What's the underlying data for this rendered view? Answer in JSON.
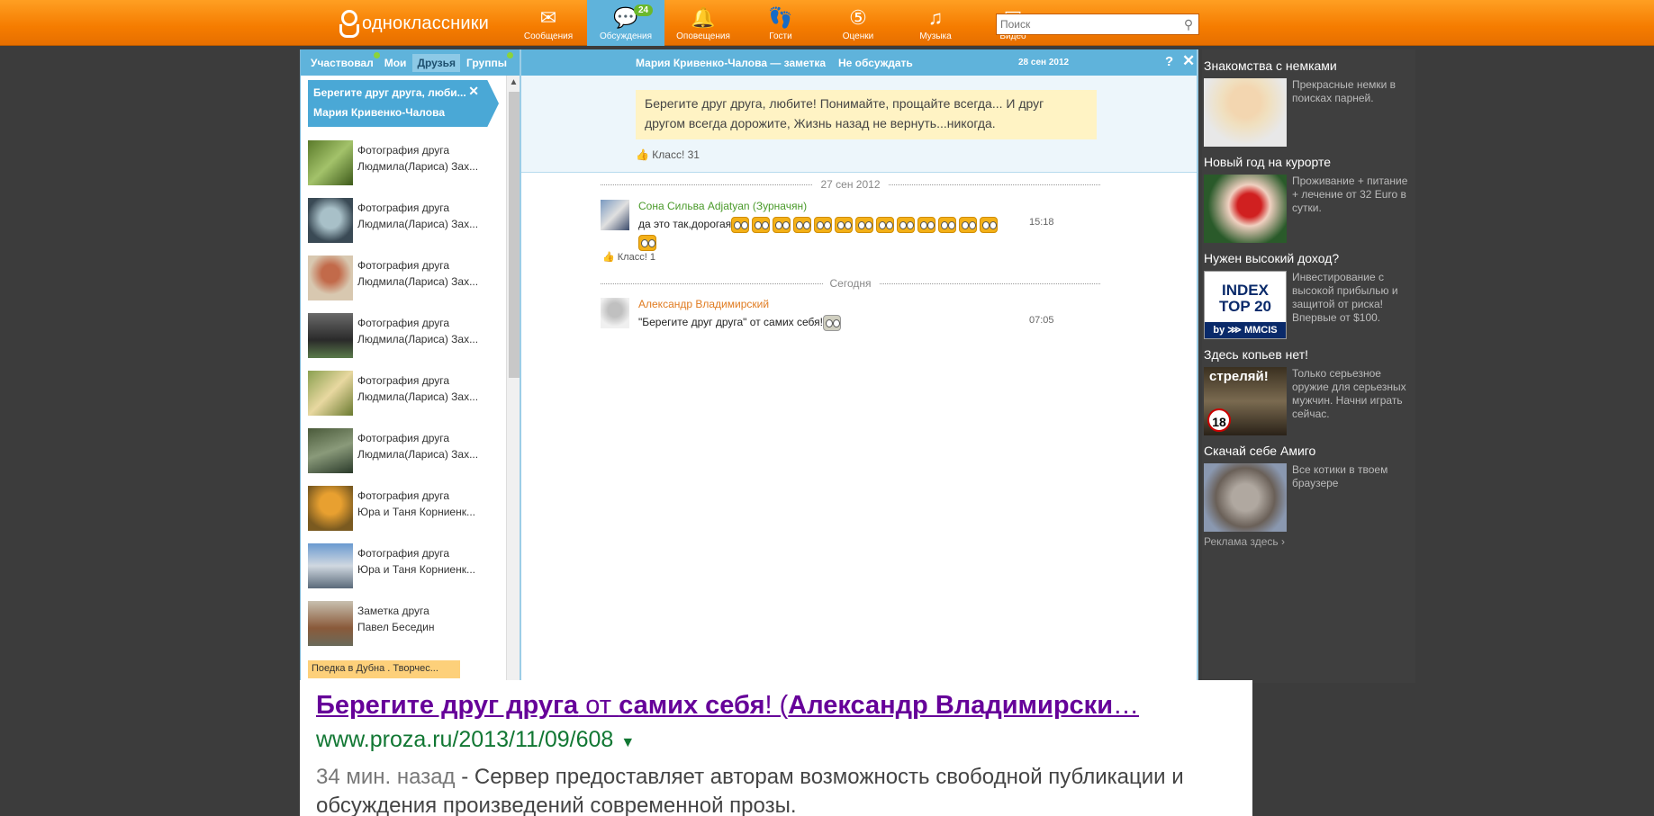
{
  "topbar": {
    "logo_text": "одноклассники",
    "nav": [
      {
        "label": "Сообщения",
        "icon": "envelope-icon",
        "glyph": "✉"
      },
      {
        "label": "Обсуждения",
        "icon": "discussions-icon",
        "glyph": "💬",
        "badge": "24",
        "active": true
      },
      {
        "label": "Оповещения",
        "icon": "bell-icon",
        "glyph": "🔔"
      },
      {
        "label": "Гости",
        "icon": "footprints-icon",
        "glyph": "👣"
      },
      {
        "label": "Оценки",
        "icon": "ratings-icon",
        "glyph": "⑤"
      },
      {
        "label": "Музыка",
        "icon": "music-icon",
        "glyph": "♫"
      },
      {
        "label": "Видео",
        "icon": "video-icon",
        "glyph": "▣"
      }
    ],
    "search_placeholder": "Поиск"
  },
  "left": {
    "tabs": [
      "Участвовал",
      "Мои",
      "Друзья",
      "Группы"
    ],
    "current": {
      "title": "Берегите друг друга, люби...",
      "author": "Мария Кривенко-Чалова"
    },
    "items": [
      {
        "type": "Фотография друга",
        "author": "Людмила(Лариса) Зах..."
      },
      {
        "type": "Фотография друга",
        "author": "Людмила(Лариса) Зах..."
      },
      {
        "type": "Фотография друга",
        "author": "Людмила(Лариса) Зах..."
      },
      {
        "type": "Фотография друга",
        "author": "Людмила(Лариса) Зах..."
      },
      {
        "type": "Фотография друга",
        "author": "Людмила(Лариса) Зах..."
      },
      {
        "type": "Фотография друга",
        "author": "Людмила(Лариса) Зах..."
      },
      {
        "type": "Фотография друга",
        "author": "Юра и Таня Корниенк..."
      },
      {
        "type": "Фотография друга",
        "author": "Юра и Таня Корниенк..."
      },
      {
        "type": "Заметка друга",
        "author": "Павел Беседин"
      }
    ],
    "tag": "Поедка в Дубна . Творчес..."
  },
  "main": {
    "header_title": "Мария Кривенко-Чалова — заметка",
    "no_discuss": "Не обсуждать",
    "date": "28 сен 2012",
    "help": "?",
    "close": "✕",
    "note": "Берегите друг друга, любите! Понимайте, прощайте всегда... И друг другом всегда дорожите, Жизнь назад не вернуть...никогда.",
    "note_class": "Класс! 31",
    "sep1": "27 сен 2012",
    "msg1": {
      "author": "Сона Сильва Adjatyan (Зурначян)",
      "text": "да это так,дорогая",
      "time": "15:18",
      "klass": "Класс! 1"
    },
    "sep2": "Сегодня",
    "msg2": {
      "author": "Александр Владимирский",
      "text": "\"Берегите друг друга\" от самих себя!",
      "time": "07:05"
    }
  },
  "ads": [
    {
      "title": "Знакомства с немками",
      "desc": "Прекрасные немки в поисках парней."
    },
    {
      "title": "Новый год на курорте",
      "desc": "Проживание + питание + лечение от 32 Euro в сутки."
    },
    {
      "title": "Нужен высокий доход?",
      "desc": "Инвестирование с высокой прибылью и защитой от риска! Впервые от $100.",
      "logo_line1": "INDEX",
      "logo_line2": "TOP 20",
      "logo_line3": "by ⋙ MMCIS"
    },
    {
      "title": "Здесь копьев нет!",
      "desc": "Только серьезное оружие для серьезных мужчин. Начни играть сейчас.",
      "banner": "стреляй!",
      "age": "18"
    },
    {
      "title": "Скачай себе Амиго",
      "desc": "Все котики в твоем браузере"
    }
  ],
  "ads_more": "Реклама здесь ›",
  "result": {
    "title_parts": [
      "Берегите друг друга",
      " от ",
      "самих себя",
      "! (",
      "Александр Владимирски",
      "…"
    ],
    "url": "www.proza.ru/2013/11/09/608",
    "ago": "34 мин. назад",
    "snippet": " - Сервер предоставляет авторам возможность свободной публикации и обсуждения произведений современной прозы."
  },
  "colors": {
    "topbar": "#f57c00",
    "accent_blue": "#5fb3db",
    "author_green": "#4a9a2a",
    "author_orange": "#e07b20",
    "link_purple": "#660099",
    "url_green": "#117733"
  }
}
